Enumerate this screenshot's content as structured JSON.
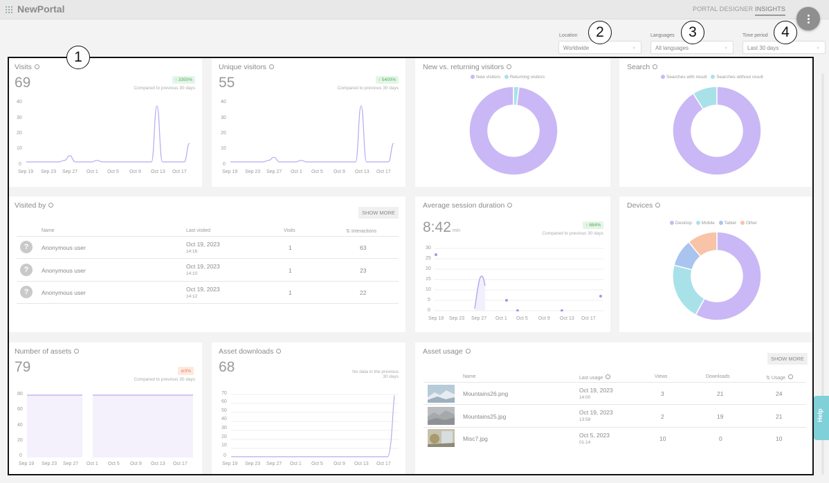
{
  "header": {
    "brand": "NewPortal",
    "nav": [
      "PORTAL DESIGNER",
      "INSIGHTS"
    ],
    "menu_icon": "more-vertical-icon"
  },
  "filters": {
    "location": {
      "label": "Location",
      "value": "Worldwide"
    },
    "languages": {
      "label": "Languages",
      "value": "All languages"
    },
    "time": {
      "label": "Time period",
      "value": "Last 30 days"
    }
  },
  "callouts": [
    "1",
    "2",
    "3",
    "4"
  ],
  "date_ticks": [
    "Sep 19",
    "Sep 23",
    "Sep 27",
    "Oct 1",
    "Oct 5",
    "Oct 9",
    "Oct 13",
    "Oct 17"
  ],
  "visits": {
    "title": "Visits",
    "value": "69",
    "change": "↑ 3350%",
    "compare": "Compared to previous 30 days",
    "y_ticks": [
      "40",
      "30",
      "20",
      "10",
      "0"
    ]
  },
  "unique": {
    "title": "Unique visitors",
    "value": "55",
    "change": "↑ 5400%",
    "compare": "Compared to previous 30 days",
    "y_ticks": [
      "40",
      "30",
      "20",
      "10",
      "0"
    ]
  },
  "new_returning": {
    "title": "New vs. returning visitors",
    "legend": [
      "New visitors",
      "Returning visitors"
    ]
  },
  "search": {
    "title": "Search",
    "legend": [
      "Searches with result",
      "Searches without result"
    ]
  },
  "visited_by": {
    "title": "Visited by",
    "show_more": "SHOW MORE",
    "columns": [
      "Name",
      "Last visited",
      "Visits",
      "Interactions"
    ],
    "rows": [
      {
        "name": "Anonymous user",
        "date": "Oct 19, 2023",
        "time": "14:16",
        "visits": "1",
        "interactions": "63"
      },
      {
        "name": "Anonymous user",
        "date": "Oct 19, 2023",
        "time": "14:10",
        "visits": "1",
        "interactions": "23"
      },
      {
        "name": "Anonymous user",
        "date": "Oct 19, 2023",
        "time": "14:12",
        "visits": "1",
        "interactions": "22"
      }
    ]
  },
  "session": {
    "title": "Average session duration",
    "value": "8:42",
    "unit": "min",
    "change": "↑ 684%",
    "compare": "Compared to previous 30 days",
    "y_ticks": [
      "30",
      "25",
      "20",
      "15",
      "10",
      "5",
      "0"
    ],
    "x_ticks": [
      "Sep 19",
      "Sep 23",
      "Sep 27",
      "Oct 1",
      "Oct 5",
      "Oct 9",
      "Oct 13",
      "Oct 17"
    ]
  },
  "devices": {
    "title": "Devices",
    "legend": [
      "Desktop",
      "Mobile",
      "Tablet",
      "Other"
    ]
  },
  "assets": {
    "title": "Number of assets",
    "value": "79",
    "change": "⊖0%",
    "compare": "Compared to previous 30 days",
    "y_ticks": [
      "80",
      "60",
      "40",
      "20",
      "0"
    ]
  },
  "downloads": {
    "title": "Asset downloads",
    "value": "68",
    "compare": "No data in the previous 30 days",
    "y_ticks": [
      "70",
      "60",
      "50",
      "40",
      "30",
      "20",
      "10",
      "0"
    ]
  },
  "asset_usage": {
    "title": "Asset usage",
    "show_more": "SHOW MORE",
    "columns": [
      "Name",
      "Last usage",
      "Views",
      "Downloads",
      "Usage"
    ],
    "rows": [
      {
        "name": "Mountains26.png",
        "date": "Oct 19, 2023",
        "time": "14:00",
        "views": "3",
        "downloads": "21",
        "usage": "24"
      },
      {
        "name": "Mountains25.jpg",
        "date": "Oct 19, 2023",
        "time": "13:58",
        "views": "2",
        "downloads": "19",
        "usage": "21"
      },
      {
        "name": "Misc7.jpg",
        "date": "Oct 5, 2023",
        "time": "01:14",
        "views": "10",
        "downloads": "0",
        "usage": "10"
      }
    ]
  },
  "help": "Help",
  "colors": {
    "purple": "#c9b8f5",
    "teal": "#a9e1e9",
    "blue": "#a9c4ee",
    "orange": "#f8c3a6",
    "line": "#b9a8f0"
  },
  "chart_data": [
    {
      "type": "line",
      "title": "Visits",
      "x": [
        "Sep 19",
        "Sep 20",
        "Sep 21",
        "Sep 22",
        "Sep 23",
        "Sep 24",
        "Sep 25",
        "Sep 26",
        "Sep 27",
        "Sep 28",
        "Sep 29",
        "Sep 30",
        "Oct 1",
        "Oct 2",
        "Oct 3",
        "Oct 4",
        "Oct 5",
        "Oct 6",
        "Oct 7",
        "Oct 8",
        "Oct 9",
        "Oct 10",
        "Oct 11",
        "Oct 12",
        "Oct 13",
        "Oct 14",
        "Oct 15",
        "Oct 16",
        "Oct 17",
        "Oct 18",
        "Oct 19"
      ],
      "values": [
        0,
        0,
        0,
        0,
        0,
        0,
        0,
        1,
        4,
        0,
        0,
        0,
        0,
        1,
        0,
        0,
        0,
        0,
        0,
        0,
        0,
        0,
        0,
        0,
        36,
        0,
        0,
        0,
        0,
        0,
        12
      ],
      "ylim": [
        0,
        40
      ]
    },
    {
      "type": "line",
      "title": "Unique visitors",
      "x": [
        "Sep 19",
        "Sep 20",
        "Sep 21",
        "Sep 22",
        "Sep 23",
        "Sep 24",
        "Sep 25",
        "Sep 26",
        "Sep 27",
        "Sep 28",
        "Sep 29",
        "Sep 30",
        "Oct 1",
        "Oct 2",
        "Oct 3",
        "Oct 4",
        "Oct 5",
        "Oct 6",
        "Oct 7",
        "Oct 8",
        "Oct 9",
        "Oct 10",
        "Oct 11",
        "Oct 12",
        "Oct 13",
        "Oct 14",
        "Oct 15",
        "Oct 16",
        "Oct 17",
        "Oct 18",
        "Oct 19"
      ],
      "values": [
        0,
        0,
        0,
        0,
        0,
        0,
        0,
        1,
        3,
        0,
        0,
        0,
        0,
        1,
        0,
        0,
        0,
        0,
        0,
        0,
        0,
        0,
        0,
        0,
        36,
        0,
        0,
        0,
        0,
        0,
        12
      ],
      "ylim": [
        0,
        40
      ]
    },
    {
      "type": "pie",
      "title": "New vs. returning visitors",
      "labels": [
        "New visitors",
        "Returning visitors"
      ],
      "values": [
        98,
        2
      ]
    },
    {
      "type": "pie",
      "title": "Search",
      "labels": [
        "Searches with result",
        "Searches without result"
      ],
      "values": [
        91,
        9
      ]
    },
    {
      "type": "scatter",
      "title": "Average session duration",
      "x": [
        "Sep 19",
        "Sep 27",
        "Oct 1",
        "Oct 5",
        "Oct 13",
        "Oct 19"
      ],
      "values": [
        27,
        17,
        5,
        0,
        0,
        7
      ],
      "ylim": [
        0,
        30
      ]
    },
    {
      "type": "pie",
      "title": "Devices",
      "labels": [
        "Desktop",
        "Mobile",
        "Tablet",
        "Other"
      ],
      "values": [
        58,
        21,
        10,
        11
      ]
    },
    {
      "type": "area",
      "title": "Number of assets",
      "x": [
        "Sep 19",
        "Sep 27",
        "Oct 1",
        "Oct 19"
      ],
      "values": [
        79,
        79,
        79,
        79
      ],
      "ylim": [
        0,
        80
      ]
    },
    {
      "type": "line",
      "title": "Asset downloads",
      "x": [
        "Sep 19",
        "Oct 17",
        "Oct 19"
      ],
      "values": [
        0,
        0,
        68
      ],
      "ylim": [
        0,
        70
      ]
    }
  ]
}
